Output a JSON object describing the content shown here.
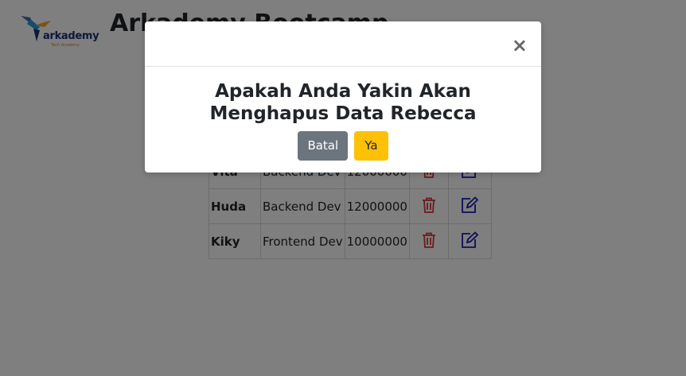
{
  "header": {
    "logo_word": "arkademy",
    "logo_sub": "Tech Academy",
    "title": "Arkademy Bootcamp"
  },
  "table": {
    "rows": [
      {
        "name": "Vita",
        "role": "Backend Dev",
        "salary": "12000000"
      },
      {
        "name": "Huda",
        "role": "Backend Dev",
        "salary": "12000000"
      },
      {
        "name": "Kiky",
        "role": "Frontend Dev",
        "salary": "10000000"
      }
    ],
    "delete_icon": "trash-icon",
    "edit_icon": "edit-icon",
    "delete_color": "#d9363e",
    "edit_color": "#1a1ab8"
  },
  "modal": {
    "close_label": "×",
    "message": "Apakah Anda Yakin Akan Menghapus Data Rebecca",
    "cancel_label": "Batal",
    "confirm_label": "Ya"
  },
  "colors": {
    "cancel_bg": "#6c757d",
    "confirm_bg": "#ffc107",
    "overlay": "rgba(0,0,0,0.5)"
  }
}
